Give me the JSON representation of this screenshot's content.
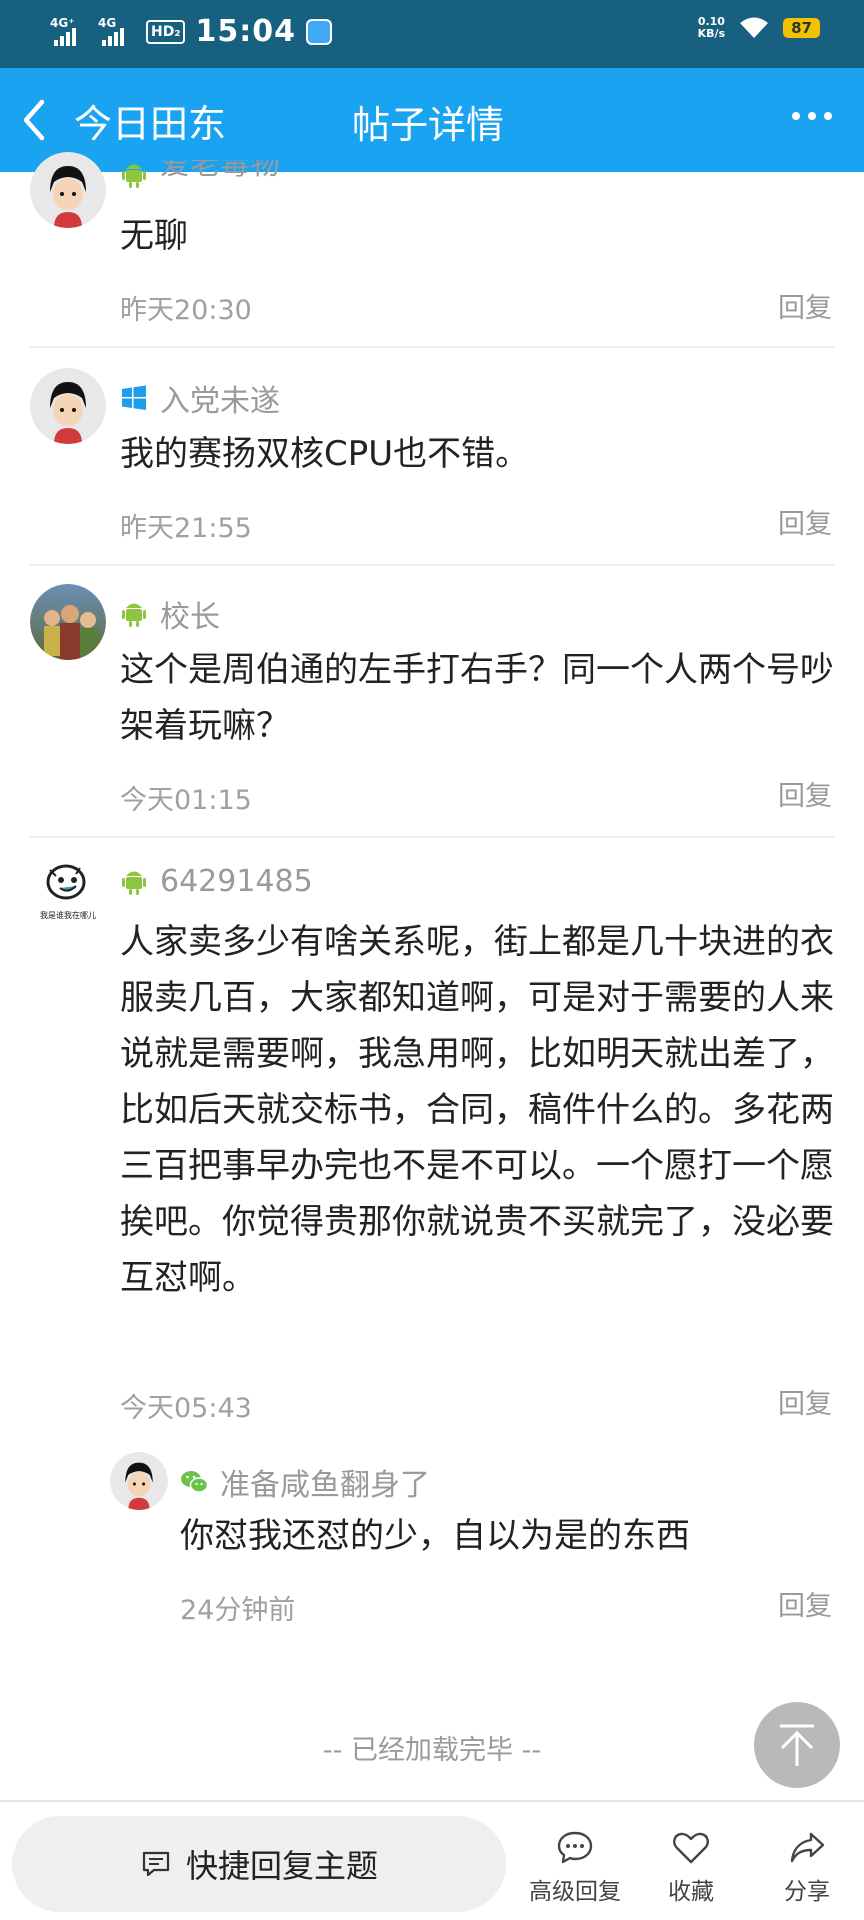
{
  "status_bar": {
    "net1": "4G⁺",
    "net2": "4G",
    "hd": "HD₂",
    "time": "15:04",
    "speed_value": "0.10",
    "speed_unit": "KB/s",
    "battery": "87"
  },
  "header": {
    "back_label": "今日田东",
    "title": "帖子详情"
  },
  "comments": [
    {
      "user": "爱老毒物",
      "platform": "android",
      "text": "无聊",
      "time": "昨天20:30",
      "reply": "回复"
    },
    {
      "user": "入党未遂",
      "platform": "windows",
      "text": "我的赛扬双核CPU也不错。",
      "time": "昨天21:55",
      "reply": "回复"
    },
    {
      "user": "校长",
      "platform": "android",
      "text": "这个是周伯通的左手打右手？同一个人两个号吵架着玩嘛？",
      "time": "今天01:15",
      "reply": "回复"
    },
    {
      "user": "64291485",
      "platform": "android",
      "avatar_caption": "我是谁我在哪儿",
      "text": "人家卖多少有啥关系呢，街上都是几十块进的衣服卖几百，大家都知道啊，可是对于需要的人来说就是需要啊，我急用啊，比如明天就出差了，比如后天就交标书，合同，稿件什么的。多花两三百把事早办完也不是不可以。一个愿打一个愿挨吧。你觉得贵那你就说贵不买就完了，没必要互怼啊。",
      "time": "今天05:43",
      "reply": "回复"
    }
  ],
  "sub_reply": {
    "user": "准备咸鱼翻身了",
    "platform": "wechat",
    "text": "你怼我还怼的少，自以为是的东西",
    "time": "24分钟前",
    "reply": "回复"
  },
  "load_done": "-- 已经加载完毕 --",
  "bottom_bar": {
    "quick_reply": "快捷回复主题",
    "advanced_reply": "高级回复",
    "favorite": "收藏",
    "share": "分享"
  },
  "colors": {
    "header_bg": "#1aa3f0",
    "status_bg": "#17607f",
    "android_green": "#8cc63f",
    "windows_blue": "#1e9de8",
    "wechat_green": "#6cc24a"
  }
}
